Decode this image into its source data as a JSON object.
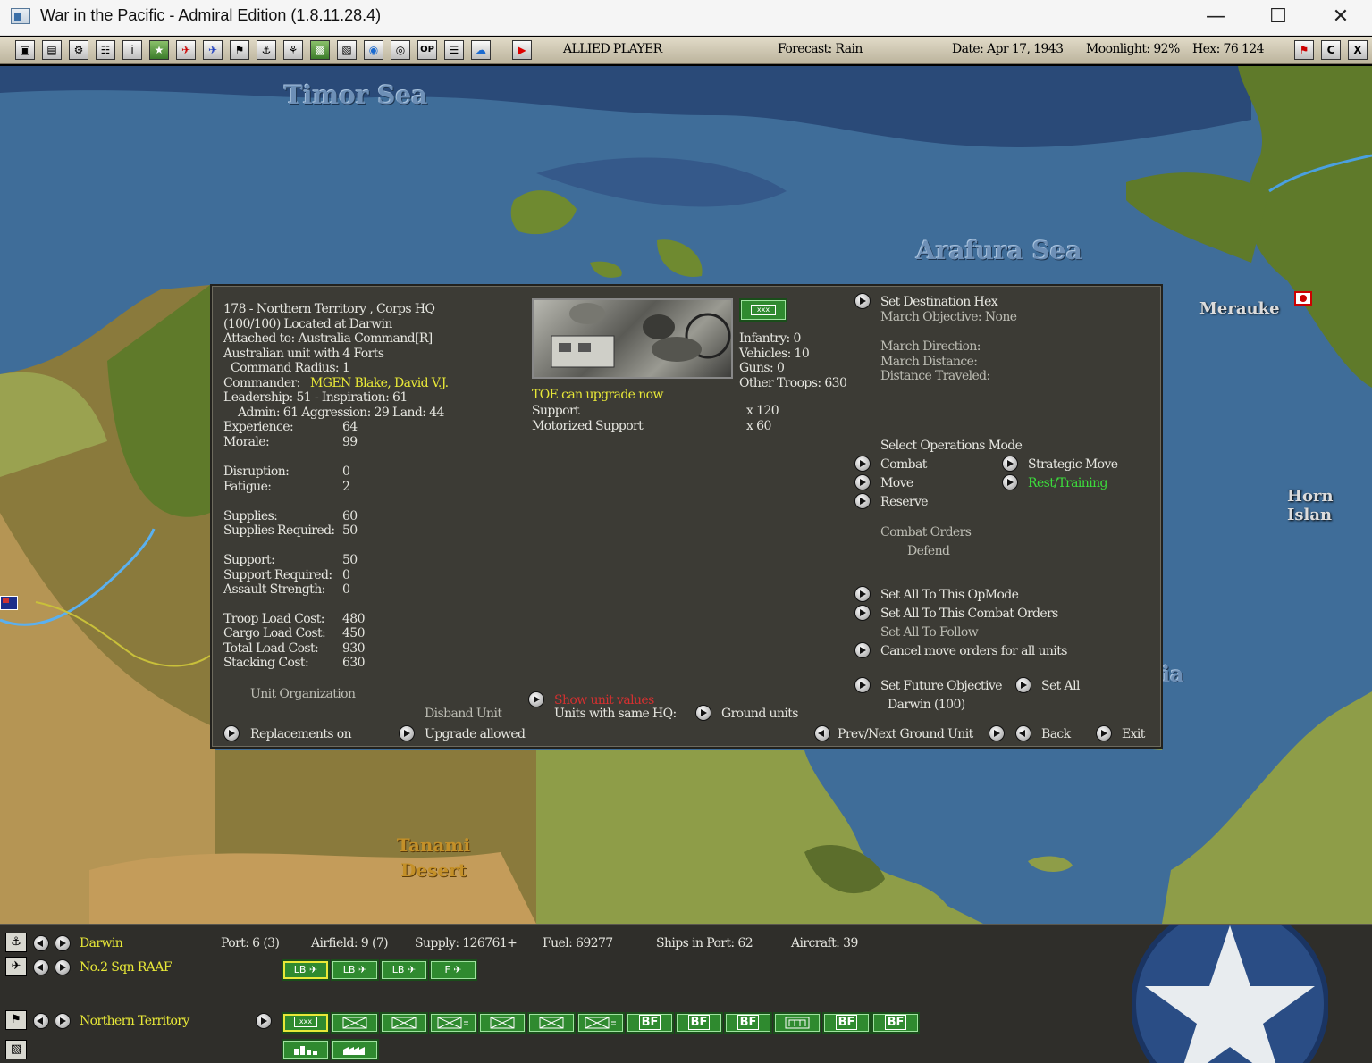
{
  "window": {
    "title": "War in the Pacific - Admiral Edition (1.8.11.28.4)"
  },
  "toolbar": {
    "player": "ALLIED PLAYER",
    "forecast": "Forecast: Rain",
    "date": "Date: Apr 17, 1943",
    "moonlight": "Moonlight: 92%",
    "hex": "Hex: 76 124",
    "op_label": "OP",
    "c_label": "C",
    "x_label": "X"
  },
  "map": {
    "timor_sea": "Timor Sea",
    "arafura_sea": "Arafura Sea",
    "merauke": "Merauke",
    "horn_island": "Horn Islan",
    "tanami_line1": "Tanami",
    "tanami_line2": "Desert",
    "partial_label": "ia"
  },
  "unit": {
    "line1": "178 - Northern Territory , Corps HQ",
    "line2": "(100/100) Located at  Darwin",
    "attached": "Attached to:  Australia Command[R]",
    "desc": "Australian unit with 4 Forts",
    "radius": "Command Radius: 1",
    "commander_label": "Commander:",
    "commander": "MGEN Blake, David V.J.",
    "leadership": "Leadership: 51 - Inspiration: 61",
    "admin": "Admin: 61   Aggression: 29  Land: 44",
    "stats": [
      {
        "label": "Experience:",
        "value": "64"
      },
      {
        "label": "Morale:",
        "value": "99"
      },
      {
        "label": "Disruption:",
        "value": "0"
      },
      {
        "label": "Fatigue:",
        "value": "2"
      },
      {
        "label": "Supplies:",
        "value": "60"
      },
      {
        "label": "Supplies Required:",
        "value": "50"
      },
      {
        "label": "Support:",
        "value": "50"
      },
      {
        "label": "Support Required:",
        "value": "0"
      },
      {
        "label": "Assault Strength:",
        "value": "0"
      },
      {
        "label": "Troop Load Cost:",
        "value": "480"
      },
      {
        "label": "Cargo Load Cost:",
        "value": "450"
      },
      {
        "label": "Total Load Cost:",
        "value": "930"
      },
      {
        "label": "Stacking Cost:",
        "value": "630"
      }
    ],
    "unit_organization": "Unit Organization",
    "disband": "Disband Unit",
    "replacements": "Replacements on",
    "upgrade": "Upgrade allowed",
    "unit_icon": "xxx",
    "infantry": "Infantry: 0",
    "vehicles": "Vehicles: 10",
    "guns": "Guns: 0",
    "other_troops": "Other Troops: 630",
    "toe": "TOE can upgrade now",
    "devices": [
      {
        "name": "Support",
        "qty": "x 120"
      },
      {
        "name": "Motorized Support",
        "qty": "x 60"
      }
    ],
    "show_values": "Show unit values",
    "same_hq": "Units with same HQ:",
    "ground_units": "Ground units"
  },
  "orders": {
    "set_dest": "Set Destination Hex",
    "march_obj": "March Objective: None",
    "march_dir": "March Direction:",
    "march_dist": "March Distance:",
    "dist_trav": "Distance Traveled:",
    "select_mode": "Select Operations Mode",
    "combat": "Combat",
    "move": "Move",
    "reserve": "Reserve",
    "strategic": "Strategic Move",
    "rest": "Rest/Training",
    "combat_orders": "Combat Orders",
    "defend": "Defend",
    "set_all_opmode": "Set All To This OpMode",
    "set_all_combat": "Set All To This Combat Orders",
    "set_all_follow": "Set All To Follow",
    "cancel_move": "Cancel move orders for all units",
    "future_obj": "Set Future Objective",
    "set_all": "Set All",
    "darwin": "Darwin (100)",
    "prevnext": "Prev/Next Ground Unit",
    "back": "Back",
    "exit": "Exit"
  },
  "bottom": {
    "base": "Darwin",
    "port": "Port: 6 (3)",
    "airfield": "Airfield: 9 (7)",
    "supply": "Supply: 126761+",
    "fuel": "Fuel: 69277",
    "ships": "Ships in Port: 62",
    "aircraft": "Aircraft: 39",
    "squadron": "No.2 Sqn RAAF",
    "ground": "Northern Territory",
    "air_units": [
      "LB",
      "LB",
      "LB",
      "F"
    ],
    "hq_icon": "xxx",
    "bf": "BF"
  },
  "colors": {
    "accent_yellow": "#e8e838",
    "unit_green": "#2f8a2f",
    "ocean": "#3f6d99"
  }
}
